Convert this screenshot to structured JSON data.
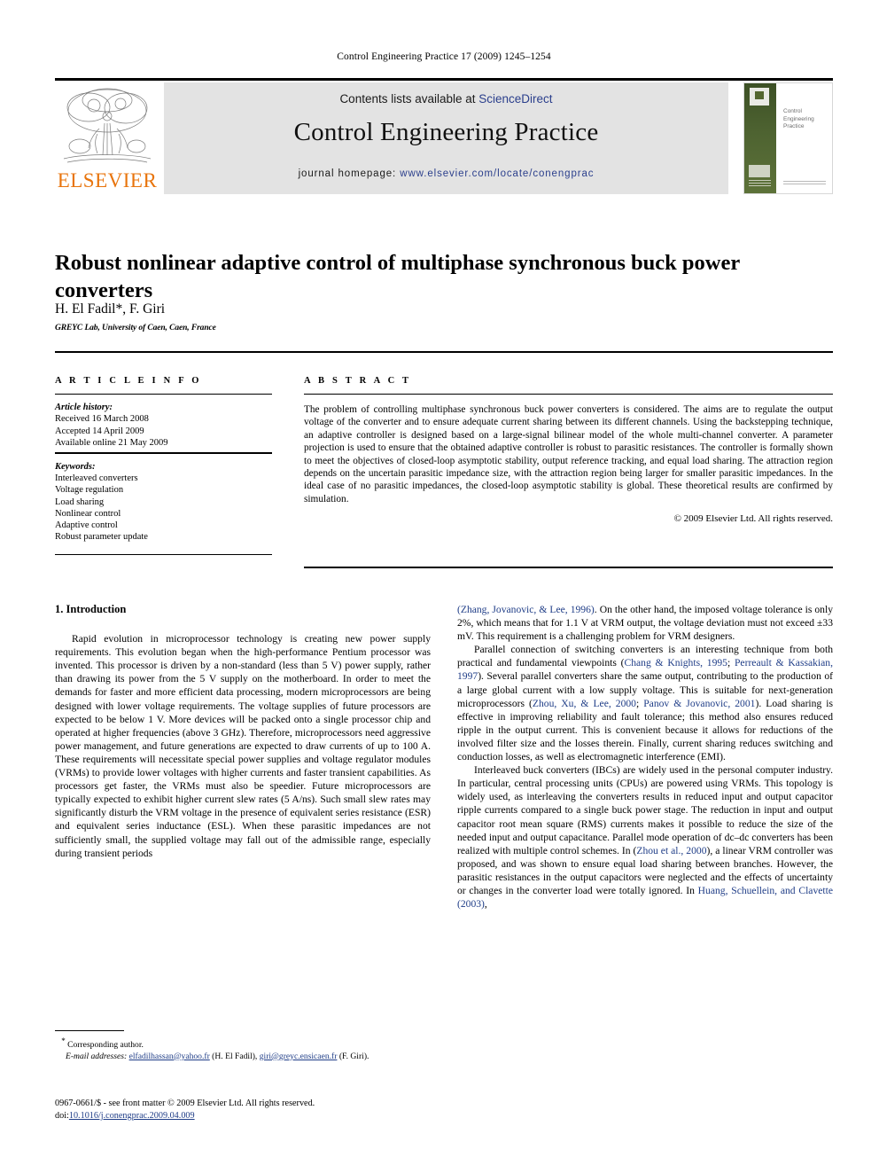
{
  "running_head": "Control Engineering Practice 17 (2009) 1245–1254",
  "masthead": {
    "contents_prefix": "Contents lists available at ",
    "sciencedirect": "ScienceDirect",
    "journal_title": "Control Engineering Practice",
    "homepage_prefix": "journal homepage: ",
    "homepage_url": "www.elsevier.com/locate/conengprac",
    "publisher": "ELSEVIER",
    "cover_title": "Control Engineering Practice",
    "link_color": "#2b3f8c",
    "band_color": "#4e6331",
    "elsevier_orange": "#E8740C"
  },
  "article": {
    "title": "Robust nonlinear adaptive control of multiphase synchronous buck power converters",
    "authors": "H. El Fadil*, F. Giri",
    "affiliation": "GREYC Lab, University of Caen, Caen, France"
  },
  "info": {
    "heading": "A R T I C L E   I N F O",
    "history_label": "Article history:",
    "history": [
      "Received 16 March 2008",
      "Accepted 14 April 2009",
      "Available online 21 May 2009"
    ],
    "keywords_label": "Keywords:",
    "keywords": [
      "Interleaved converters",
      "Voltage regulation",
      "Load sharing",
      "Nonlinear control",
      "Adaptive control",
      "Robust parameter update"
    ]
  },
  "abstract": {
    "heading": "A B S T R A C T",
    "text": "The problem of controlling multiphase synchronous buck power converters is considered. The aims are to regulate the output voltage of the converter and to ensure adequate current sharing between its different channels. Using the backstepping technique, an adaptive controller is designed based on a large-signal bilinear model of the whole multi-channel converter. A parameter projection is used to ensure that the obtained adaptive controller is robust to parasitic resistances. The controller is formally shown to meet the objectives of closed-loop asymptotic stability, output reference tracking, and equal load sharing. The attraction region depends on the uncertain parasitic impedance size, with the attraction region being larger for smaller parasitic impedances. In the ideal case of no parasitic impedances, the closed-loop asymptotic stability is global. These theoretical results are confirmed by simulation.",
    "copyright": "© 2009 Elsevier Ltd. All rights reserved."
  },
  "body": {
    "section_number_title": "1.  Introduction",
    "left_paragraph_1": "Rapid evolution in microprocessor technology is creating new power supply requirements. This evolution began when the high-performance Pentium processor was invented. This processor is driven by a non-standard (less than 5 V) power supply, rather than drawing its power from the 5 V supply on the motherboard. In order to meet the demands for faster and more efficient data processing, modern microprocessors are being designed with lower voltage requirements. The voltage supplies of future processors are expected to be below 1 V. More devices will be packed onto a single processor chip and operated at higher frequencies (above 3 GHz). Therefore, microprocessors need aggressive power management, and future generations are expected to draw currents of up to 100 A. These requirements will necessitate special power supplies and voltage regulator modules (VRMs) to provide lower voltages with higher currents and faster transient capabilities. As processors get faster, the VRMs must also be speedier. Future microprocessors are typically expected to exhibit higher current slew rates (5 A/ns). Such small slew rates may significantly disturb the VRM voltage in the presence of equivalent series resistance (ESR) and equivalent series inductance (ESL). When these parasitic impedances are not sufficiently small, the supplied voltage may fall out of the admissible range, especially during transient periods",
    "right_p1_ref": "(Zhang, Jovanovic, & Lee, 1996)",
    "right_p1_rest": ". On the other hand, the imposed voltage tolerance is only 2%, which means that for 1.1 V at VRM output, the voltage deviation must not exceed ±33 mV. This requirement is a challenging problem for VRM designers.",
    "right_p2_a": "Parallel connection of switching converters is an interesting technique from both practical and fundamental viewpoints (",
    "right_p2_ref1": "Chang & Knights, 1995",
    "right_p2_b": "; ",
    "right_p2_ref2": "Perreault & Kassakian, 1997",
    "right_p2_c": "). Several parallel converters share the same output, contributing to the production of a large global current with a low supply voltage. This is suitable for next-generation microprocessors (",
    "right_p2_ref3": "Zhou, Xu, & Lee, 2000",
    "right_p2_d": "; ",
    "right_p2_ref4": "Panov & Jovanovic, 2001",
    "right_p2_e": "). Load sharing is effective in improving reliability and fault tolerance; this method also ensures reduced ripple in the output current. This is convenient because it allows for reductions of the involved filter size and the losses therein. Finally, current sharing reduces switching and conduction losses, as well as electromagnetic interference (EMI).",
    "right_p3_a": "Interleaved buck converters (IBCs) are widely used in the personal computer industry. In particular, central processing units (CPUs) are powered using VRMs. This topology is widely used, as interleaving the converters results in reduced input and output capacitor ripple currents compared to a single buck power stage. The reduction in input and output capacitor root mean square (RMS) currents makes it possible to reduce the size of the needed input and output capacitance. Parallel mode operation of dc–dc converters has been realized with multiple control schemes. In (",
    "right_p3_ref1": "Zhou et al., 2000",
    "right_p3_b": "), a linear VRM controller was proposed, and was shown to ensure equal load sharing between branches. However, the parasitic resistances in the output capacitors were neglected and the effects of uncertainty or changes in the converter load were totally ignored. In ",
    "right_p3_ref2": "Huang, Schuellein, and Clavette (2003)",
    "right_p3_c": ","
  },
  "footnote": {
    "corresponding_marker": "*",
    "corresponding_text": " Corresponding author.",
    "email_label": "E-mail addresses:",
    "email1": "elfadilhassan@yahoo.fr",
    "email1_owner": " (H. El Fadil), ",
    "email2": "giri@greyc.ensicaen.fr",
    "email2_owner": " (F. Giri)."
  },
  "imprint": {
    "issn_line": "0967-0661/$ - see front matter © 2009 Elsevier Ltd. All rights reserved.",
    "doi_prefix": "doi:",
    "doi_value": "10.1016/j.conengprac.2009.04.009"
  }
}
